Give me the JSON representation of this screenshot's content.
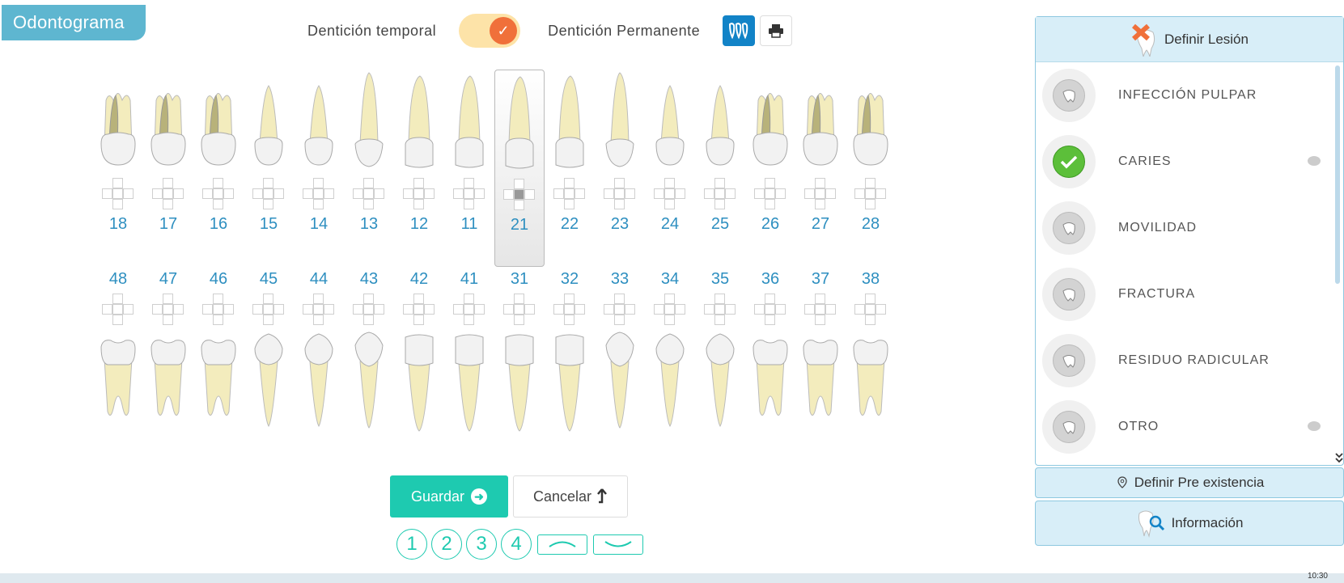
{
  "header": {
    "title": "Odontograma"
  },
  "dentition": {
    "temporal_label": "Dentición temporal",
    "permanent_label": "Dentición Permanente",
    "toggle_on": true
  },
  "toolbar": {
    "teeth_icon": "teeth-icon",
    "print_icon": "printer-icon"
  },
  "upper_teeth": [
    {
      "num": "18",
      "type": "molar"
    },
    {
      "num": "17",
      "type": "molar"
    },
    {
      "num": "16",
      "type": "molar"
    },
    {
      "num": "15",
      "type": "premolar"
    },
    {
      "num": "14",
      "type": "premolar"
    },
    {
      "num": "13",
      "type": "canine"
    },
    {
      "num": "12",
      "type": "incisor"
    },
    {
      "num": "11",
      "type": "incisor"
    },
    {
      "num": "21",
      "type": "incisor",
      "selected": true,
      "marked": true
    },
    {
      "num": "22",
      "type": "incisor"
    },
    {
      "num": "23",
      "type": "canine"
    },
    {
      "num": "24",
      "type": "premolar"
    },
    {
      "num": "25",
      "type": "premolar"
    },
    {
      "num": "26",
      "type": "molar"
    },
    {
      "num": "27",
      "type": "molar"
    },
    {
      "num": "28",
      "type": "molar"
    }
  ],
  "lower_teeth": [
    {
      "num": "48",
      "type": "molar"
    },
    {
      "num": "47",
      "type": "molar"
    },
    {
      "num": "46",
      "type": "molar"
    },
    {
      "num": "45",
      "type": "premolar"
    },
    {
      "num": "44",
      "type": "premolar"
    },
    {
      "num": "43",
      "type": "canine"
    },
    {
      "num": "42",
      "type": "incisor"
    },
    {
      "num": "41",
      "type": "incisor"
    },
    {
      "num": "31",
      "type": "incisor"
    },
    {
      "num": "32",
      "type": "incisor"
    },
    {
      "num": "33",
      "type": "canine"
    },
    {
      "num": "34",
      "type": "premolar"
    },
    {
      "num": "35",
      "type": "premolar"
    },
    {
      "num": "36",
      "type": "molar"
    },
    {
      "num": "37",
      "type": "molar"
    },
    {
      "num": "38",
      "type": "molar"
    }
  ],
  "actions": {
    "save_label": "Guardar",
    "cancel_label": "Cancelar"
  },
  "quadrants": [
    "1",
    "2",
    "3",
    "4"
  ],
  "panel": {
    "title": "Definir Lesión",
    "lesions": [
      {
        "name": "INFECCIÓN PULPAR",
        "selected": false,
        "comment": false
      },
      {
        "name": "CARIES",
        "selected": true,
        "comment": true
      },
      {
        "name": "MOVILIDAD",
        "selected": false,
        "comment": false
      },
      {
        "name": "FRACTURA",
        "selected": false,
        "comment": false
      },
      {
        "name": "RESIDUO RADICULAR",
        "selected": false,
        "comment": false
      },
      {
        "name": "OTRO",
        "selected": false,
        "comment": true
      }
    ],
    "pre_existence_label": "Definir Pre existencia",
    "info_label": "Información"
  },
  "colors": {
    "accent": "#1ecab0",
    "blue": "#2e8fc0",
    "root": "#f3ecbd",
    "crown": "#f2f2f2"
  },
  "taskbar": {
    "clock": "10:30"
  }
}
